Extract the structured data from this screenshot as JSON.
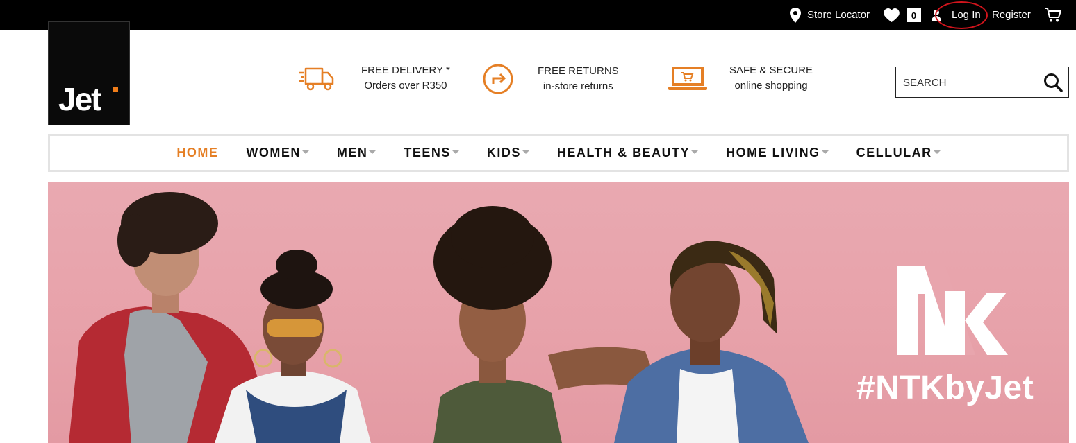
{
  "topbar": {
    "store_locator": "Store Locator",
    "wishlist_count": "0",
    "login": "Log In",
    "register": "Register"
  },
  "logo": {
    "text": "Jet"
  },
  "usps": [
    {
      "icon": "delivery-truck-icon",
      "line1": "FREE DELIVERY *",
      "line2": "Orders over R350"
    },
    {
      "icon": "returns-icon",
      "line1": "FREE RETURNS",
      "line2": "in-store returns"
    },
    {
      "icon": "laptop-cart-icon",
      "line1": "SAFE & SECURE",
      "line2": "online shopping"
    }
  ],
  "search": {
    "placeholder": "SEARCH"
  },
  "nav": [
    {
      "label": "HOME",
      "active": true,
      "dropdown": false
    },
    {
      "label": "WOMEN",
      "dropdown": true
    },
    {
      "label": "MEN",
      "dropdown": true
    },
    {
      "label": "TEENS",
      "dropdown": true
    },
    {
      "label": "KIDS",
      "dropdown": true
    },
    {
      "label": "HEALTH & BEAUTY",
      "dropdown": true
    },
    {
      "label": "HOME LIVING",
      "dropdown": true
    },
    {
      "label": "CELLULAR",
      "dropdown": true
    }
  ],
  "hero": {
    "brand_logo": "NTK",
    "tagline": "#NTKbyJet"
  },
  "colors": {
    "accent": "#e57f25",
    "topbar": "#000000",
    "hero_bg": "#e8a5ad",
    "highlight_circle": "#d1141c"
  }
}
